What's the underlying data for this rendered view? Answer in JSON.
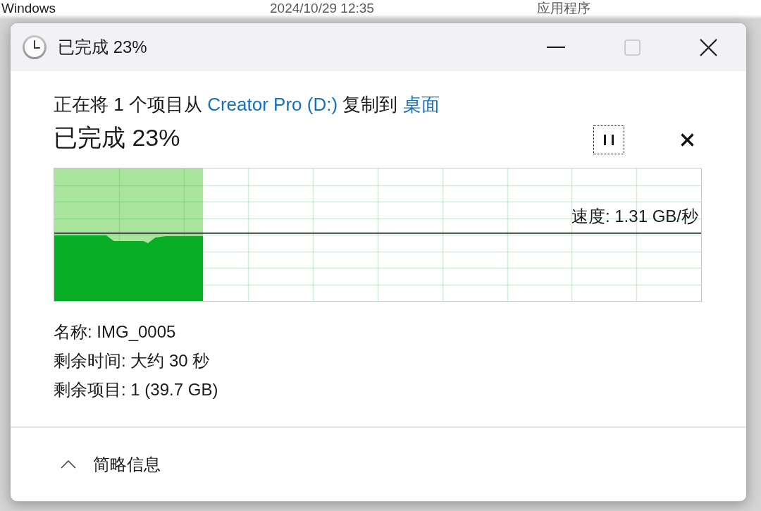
{
  "background_row": {
    "cells": [
      "Windows",
      "2024/10/29 12:35",
      "应用程序"
    ]
  },
  "window": {
    "title": "已完成 23%",
    "controls": [
      {
        "kind": "minimize",
        "disabled": false
      },
      {
        "kind": "maximize",
        "disabled": true
      },
      {
        "kind": "close",
        "disabled": false
      }
    ]
  },
  "description": [
    {
      "kind": "text",
      "text": "正在将 1 个项目从"
    },
    {
      "kind": "link",
      "text": "Creator Pro (D:)"
    },
    {
      "kind": "text",
      "text": "复制到"
    },
    {
      "kind": "link",
      "text": "桌面"
    }
  ],
  "heading": "已完成 23%",
  "actions": [
    {
      "kind": "pause",
      "focused": true
    },
    {
      "kind": "cancel",
      "focused": false
    }
  ],
  "graph": {
    "level": 0.23,
    "speed": "速度: 1.31 GB/秒"
  },
  "details": [
    "名称: IMG_0005",
    "剩余时间: 大约 30 秒",
    "剩余项目: 1 (39.7 GB)"
  ],
  "footer": {
    "toggle": "简略信息"
  }
}
